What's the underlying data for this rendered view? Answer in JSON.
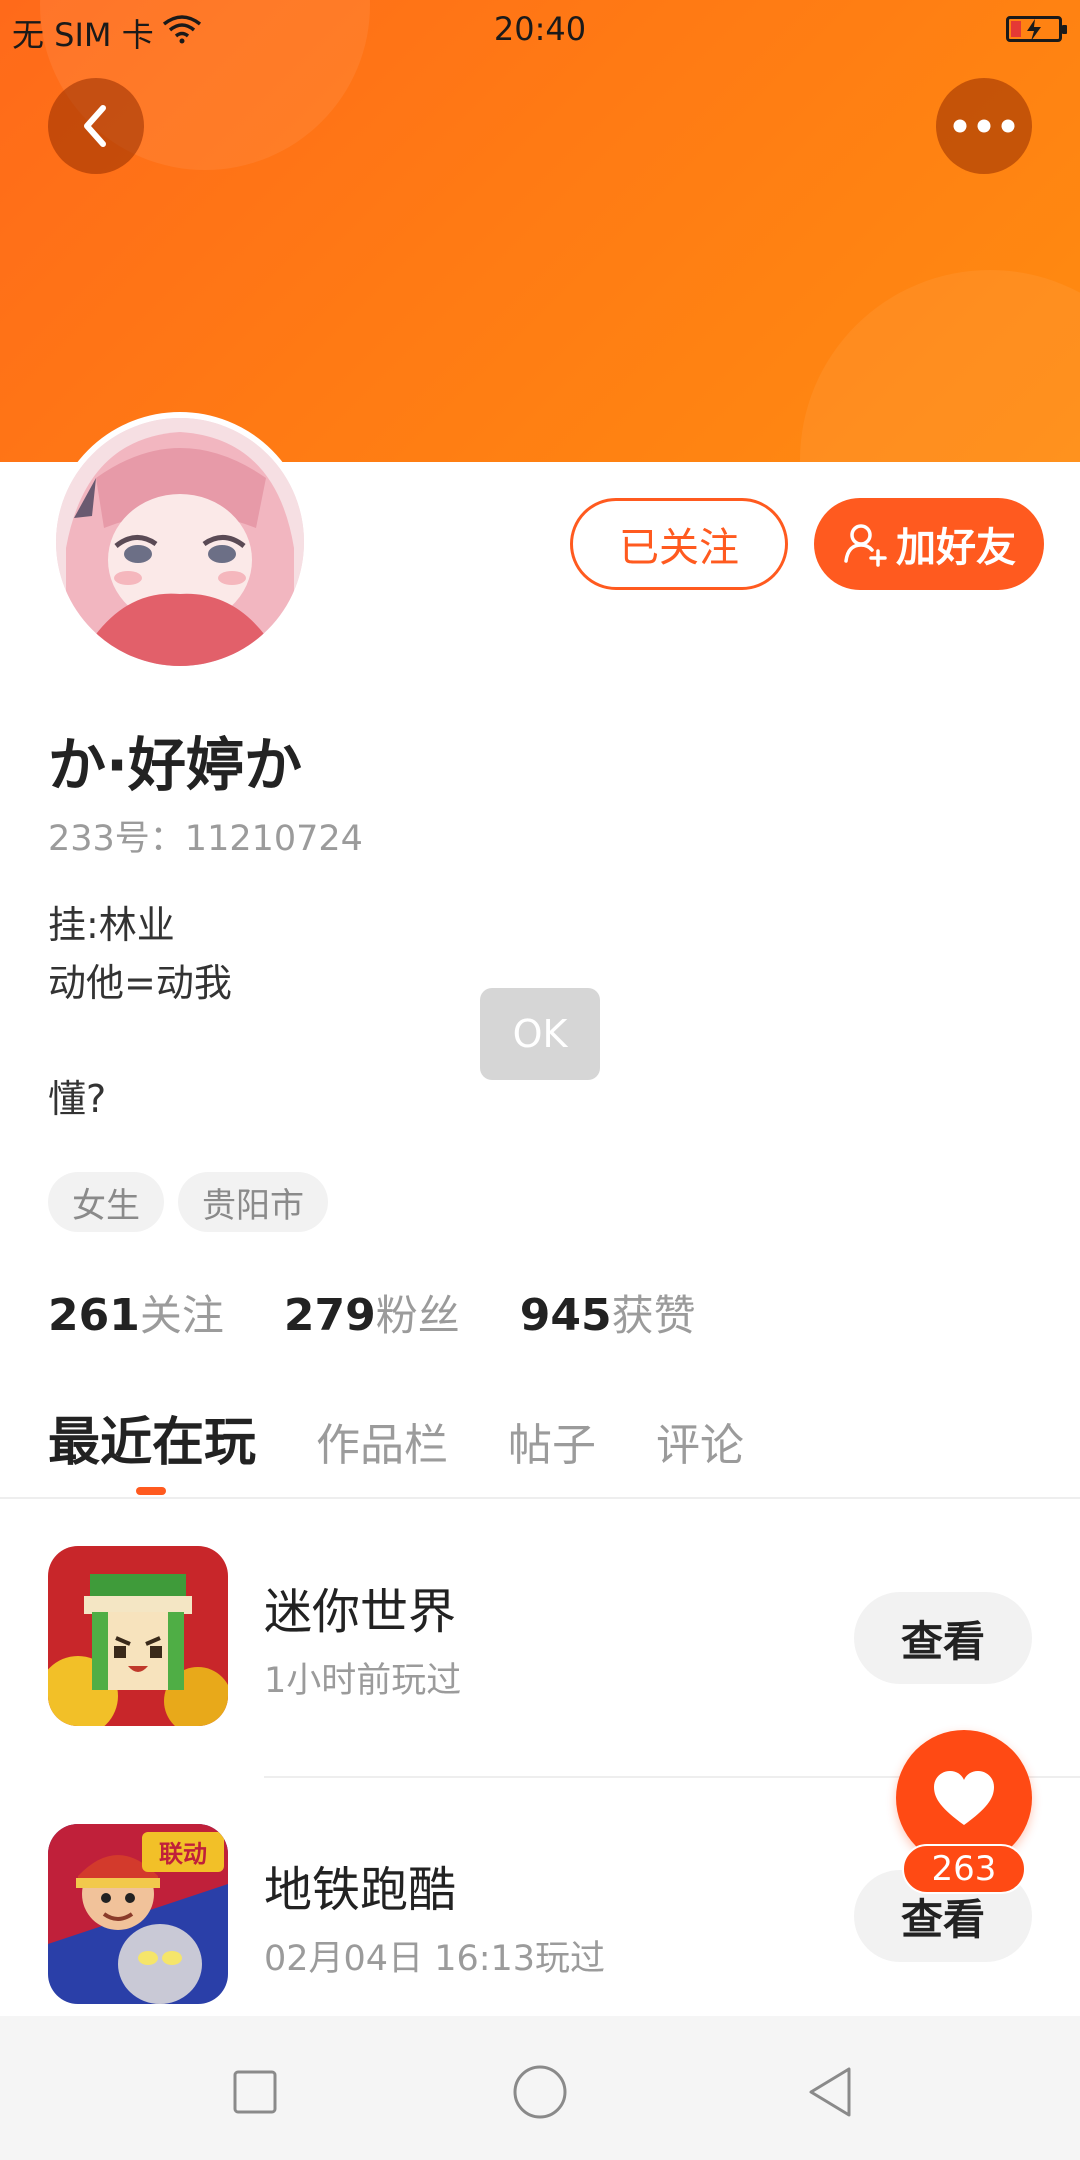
{
  "status_bar": {
    "carrier": "无 SIM 卡",
    "time": "20:40",
    "battery_level_percent": 15
  },
  "profile": {
    "username": "か·好婷か",
    "uid_label": "233号：11210724",
    "bio": "挂:林业\n动他=动我\n\n懂?",
    "tags": [
      "女生",
      "贵阳市"
    ],
    "followed_label": "已关注",
    "add_friend_label": "加好友"
  },
  "stats": [
    {
      "num": "261",
      "label": "关注"
    },
    {
      "num": "279",
      "label": "粉丝"
    },
    {
      "num": "945",
      "label": "获赞"
    }
  ],
  "toast": "OK",
  "tabs": [
    "最近在玩",
    "作品栏",
    "帖子",
    "评论"
  ],
  "games": [
    {
      "name": "迷你世界",
      "time": "1小时前玩过",
      "button": "查看"
    },
    {
      "name": "地铁跑酷",
      "time": "02月04日 16:13玩过",
      "button": "查看",
      "icon_badge": "联动"
    }
  ],
  "like_count": "263",
  "colors": {
    "accent": "#ff5a1f",
    "banner": "#ff7a14"
  }
}
